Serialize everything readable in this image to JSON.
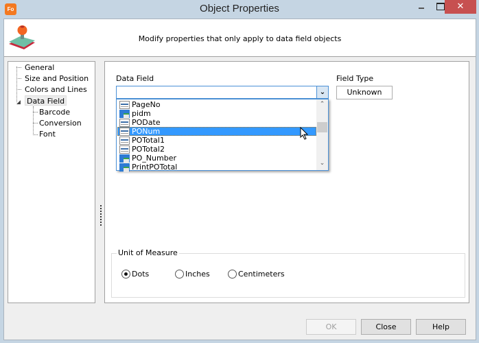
{
  "window": {
    "title": "Object Properties",
    "app_icon_text": "Fo",
    "close_glyph": "✕"
  },
  "header": {
    "description": "Modify properties that only apply to data field objects",
    "icon": "stamp-icon"
  },
  "tree": {
    "items": [
      {
        "label": "General",
        "level": 0
      },
      {
        "label": "Size and Position",
        "level": 0
      },
      {
        "label": "Colors and Lines",
        "level": 0
      },
      {
        "label": "Data Field",
        "level": 0,
        "selected": true,
        "expanded": true
      },
      {
        "label": "Barcode",
        "level": 1
      },
      {
        "label": "Conversion",
        "level": 1
      },
      {
        "label": "Font",
        "level": 1
      }
    ]
  },
  "data_field": {
    "label": "Data Field",
    "value": "",
    "dropdown_glyph": "⌄",
    "options": [
      {
        "label": "PageNo",
        "icon": "field-icon"
      },
      {
        "label": "pidm",
        "icon": "calculated-field-icon"
      },
      {
        "label": "PODate",
        "icon": "field-icon"
      },
      {
        "label": "PONum",
        "icon": "field-icon",
        "highlighted": true
      },
      {
        "label": "POTotal1",
        "icon": "field-icon"
      },
      {
        "label": "POTotal2",
        "icon": "field-icon"
      },
      {
        "label": "PO_Number",
        "icon": "calculated-field-icon"
      },
      {
        "label": "PrintPOTotal",
        "icon": "calculated-field-icon"
      }
    ],
    "scroll_up_glyph": "⌃",
    "scroll_down_glyph": "⌄"
  },
  "field_type": {
    "label": "Field Type",
    "value": "Unknown"
  },
  "unit_of_measure": {
    "label": "Unit of Measure",
    "options": [
      {
        "label": "Dots",
        "checked": true
      },
      {
        "label": "Inches",
        "checked": false
      },
      {
        "label": "Centimeters",
        "checked": false
      }
    ]
  },
  "buttons": {
    "ok": "OK",
    "close": "Close",
    "help": "Help"
  }
}
